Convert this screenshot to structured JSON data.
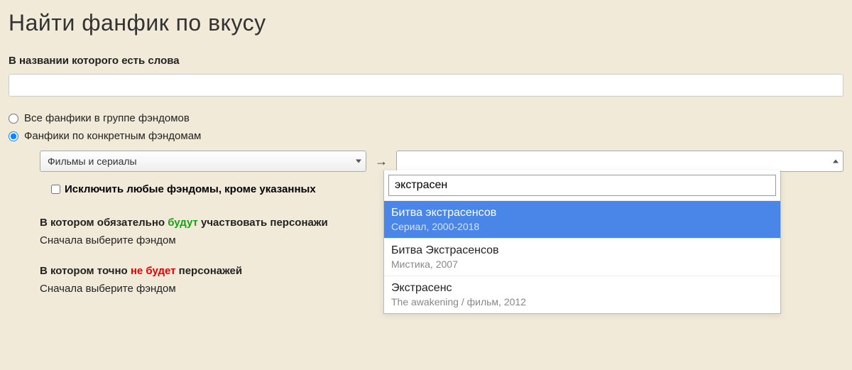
{
  "page_title": "Найти фанфик по вкусу",
  "title_words_label": "В названии которого есть слова",
  "title_value": "",
  "radios": {
    "all_in_group": "Все фанфики в группе фэндомов",
    "specific_fandoms": "Фанфики по конкретным фэндомам",
    "selected": "specific_fandoms"
  },
  "category_selected": "Фильмы и сериалы",
  "arrow": "→",
  "fandom_selected": "",
  "exclude_label": "Исключить любые фэндомы, кроме указанных",
  "section_will": {
    "prefix": "В котором обязательно ",
    "emph": "будут",
    "suffix": " участвовать персонажи"
  },
  "section_wont": {
    "prefix": "В котором точно ",
    "emph": "не будет",
    "suffix": " персонажей"
  },
  "hint_pick_first": "Сначала выберите фэндом",
  "autocomplete": {
    "query": "экстрасен",
    "items": [
      {
        "title": "Битва экстрасенсов",
        "sub": "Сериал, 2000-2018"
      },
      {
        "title": "Битва Экстрасенсов",
        "sub": "Мистика, 2007"
      },
      {
        "title": "Экстрасенс",
        "sub": "The awakening / фильм, 2012"
      }
    ],
    "highlight_index": 0
  }
}
